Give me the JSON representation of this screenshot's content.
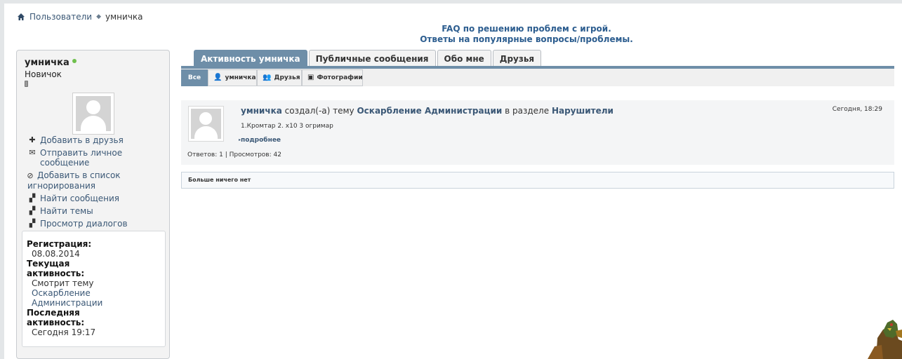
{
  "breadcrumb": {
    "users": "Пользователи",
    "current": "умничка"
  },
  "notice": {
    "line1": "FAQ по решению проблем с игрой.",
    "line2": "Ответы на популярные вопросы/проблемы."
  },
  "profile": {
    "name": "умничка",
    "rank": "Новичок",
    "actions": {
      "add_friend": "Добавить в друзья",
      "send_pm": "Отправить личное сообщение",
      "ignore": "Добавить в список игнорирования",
      "find_posts": "Найти сообщения",
      "find_threads": "Найти темы",
      "view_dialogs": "Просмотр диалогов"
    },
    "info": {
      "reg_label": "Регистрация:",
      "reg_value": "08.08.2014",
      "current_label": "Текущая активность:",
      "current_prefix": "Смотрит тему",
      "current_link": "Оскарбление Администрации",
      "last_label": "Последняя активность:",
      "last_value": "Сегодня 19:17"
    }
  },
  "tabs": {
    "activity": "Активность умничка",
    "public": "Публичные сообщения",
    "about": "Обо мне",
    "friends": "Друзья"
  },
  "subtabs": {
    "all": "Все",
    "user": "умничка",
    "friends": "Друзья",
    "photos": "Фотографии"
  },
  "activity": {
    "user": "умничка",
    "verb": " создал(-а) тему ",
    "thread": "Оскарбление Администрации",
    "in_section": " в разделе ",
    "section": "Нарушители",
    "date": "Сегодня, 18:29",
    "snippet": "1.Кромтар 2. x10 3 огримар",
    "more": "подробнее",
    "stats": "Ответов: 1 | Просмотров: 42"
  },
  "no_more": "Больше ничего нет",
  "colors": {
    "accent": "#6e8ea8",
    "link": "#3b5876",
    "notice": "#2c5d8f",
    "online": "#6fbf4c"
  }
}
